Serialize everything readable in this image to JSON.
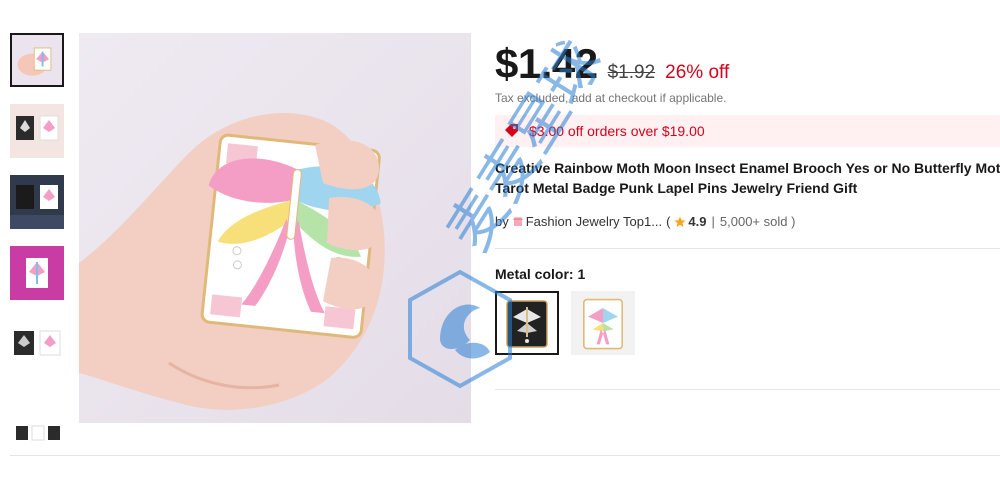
{
  "price": {
    "current": "$1.42",
    "original": "$1.92",
    "discount": "26% off",
    "tax_note": "Tax excluded, add at checkout if applicable."
  },
  "coupon": {
    "text": "$3.00 off orders over $19.00",
    "icon": "price-tag-icon"
  },
  "product": {
    "title": "Creative Rainbow Moth Moon Insect Enamel Brooch Yes or No Butterfly Moth Tarot Metal Badge Punk Lapel Pins Jewelry Friend Gift"
  },
  "store": {
    "by": "by",
    "name": "Fashion Jewelry Top1...",
    "open": "(",
    "rating": "4.9",
    "sep": "|",
    "sold": "5,000+ sold )",
    "icon": "store-icon",
    "star_icon": "star-icon"
  },
  "variant": {
    "label": "Metal color: 1",
    "options": [
      "black moth pin",
      "white rainbow moth pin"
    ],
    "selected_index": 0
  },
  "watermark": {
    "text": "麦麦星球"
  },
  "colors": {
    "price_red": "#d3031c",
    "coupon_bg": "#fff0f1",
    "watermark_blue": "#2a7fd4"
  }
}
